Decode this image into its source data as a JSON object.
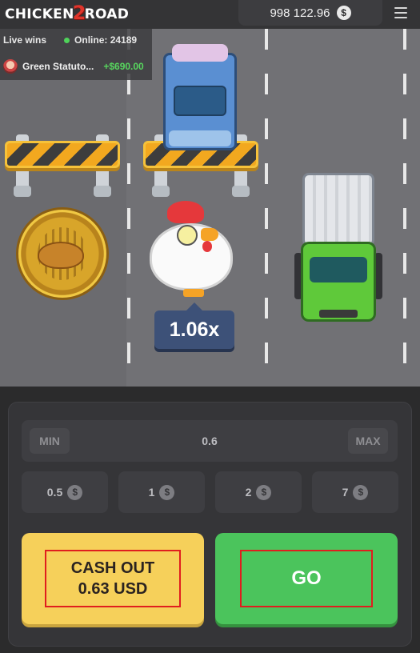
{
  "header": {
    "logo_word1": "CHICKEN",
    "logo_number": "2",
    "logo_word2": "ROAD",
    "balance": "998 122.96",
    "currency_symbol": "$"
  },
  "live_wins": {
    "label": "Live wins",
    "online_label": "Online: 24189",
    "latest_win": {
      "name": "Green Statuto...",
      "amount": "+$690.00"
    }
  },
  "game": {
    "multiplier": "1.06x"
  },
  "bet": {
    "min_label": "MIN",
    "max_label": "MAX",
    "amount": "0.6",
    "quick_amounts": [
      "0.5",
      "1",
      "2",
      "7"
    ]
  },
  "actions": {
    "cashout_line1": "CASH OUT",
    "cashout_line2": "0.63 USD",
    "go_label": "GO"
  },
  "colors": {
    "go": "#4bc45c",
    "cashout": "#f6d05a",
    "win_amount": "#57d65e",
    "highlight_frame": "#e01e1e"
  }
}
